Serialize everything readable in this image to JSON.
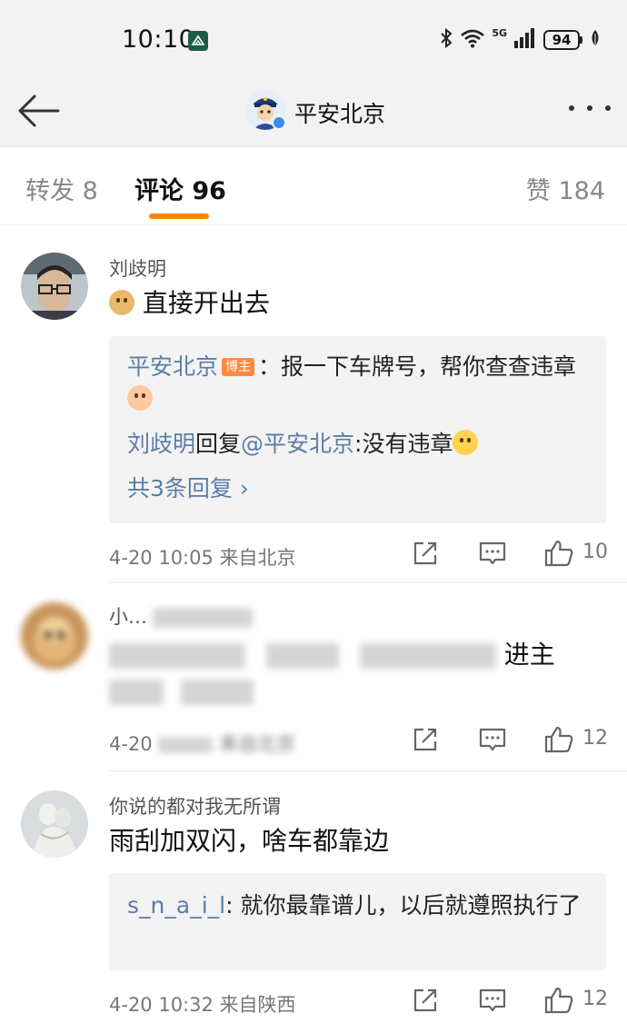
{
  "status_bar": {
    "time": "10:10",
    "network": "5G",
    "battery": "94",
    "icons": [
      "app-notification-icon",
      "bluetooth-icon",
      "wifi-icon",
      "signal-icon",
      "battery-icon",
      "leaf-icon"
    ]
  },
  "header": {
    "title": "平安北京",
    "back_icon": "back-arrow-icon",
    "more_icon": "more-dots-icon"
  },
  "tabs": [
    {
      "label": "转发 8"
    },
    {
      "label": "评论 96",
      "active": true
    },
    {
      "label": "赞 184"
    }
  ],
  "accent_color": "#ff8200",
  "link_color": "#5b7da8",
  "comments": [
    {
      "user": "刘歧明",
      "text": "直接开出去",
      "replies": {
        "first_author": "平安北京",
        "host_badge": "博主",
        "first_text": "：报一下车牌号，帮你查查违章",
        "second_author": "刘歧明",
        "second_reply_word": "回复",
        "second_mention": "@平安北京",
        "second_text": ":没有违章",
        "more": "共3条回复 ›"
      },
      "time": "4-20 10:05",
      "location": "来自北京",
      "likes": "10"
    },
    {
      "user": "小…",
      "text_visible_end": "进主",
      "time": "4-20",
      "location": "来自北京",
      "likes": "12"
    },
    {
      "user": "你说的都对我无所谓",
      "text": "雨刮加双闪，啥车都靠边",
      "replies": {
        "first_author": "s_n_a_i_l",
        "first_text": ": 就你最靠谱儿，以后就遵照执行了"
      },
      "time": "4-20 10:32",
      "location": "来自陕西",
      "likes": "12"
    }
  ]
}
